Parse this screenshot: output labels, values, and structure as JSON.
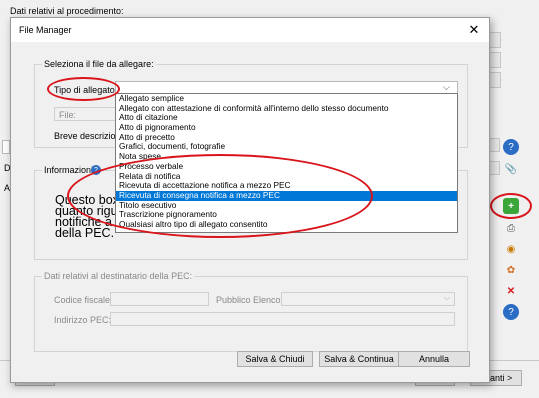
{
  "background": {
    "section_title": "Dati relativi al procedimento:",
    "label_D": "D",
    "label_Al": "Al",
    "next_button": "Avanti >"
  },
  "dialog": {
    "title": "File Manager",
    "close_glyph": "✕",
    "select_group": {
      "legend": "Seleziona il file da allegare:",
      "type_label": "Tipo di allegato:",
      "file_placeholder": "File:",
      "description_label": "Breve descrizione"
    },
    "info_group": {
      "legend": "Informazioni:",
      "help_glyph": "?",
      "text_line1": "Questo box c",
      "text_line2": "quanto riguar",
      "text_line3": "notifiche a me",
      "text_line4": "della PEC."
    },
    "type_options": [
      "Allegato semplice",
      "Allegato con attestazione di conformità all'interno dello stesso documento",
      "Atto di citazione",
      "Atto di pignoramento",
      "Atto di precetto",
      "Grafici, documenti, fotografie",
      "Nota spese",
      "Processo verbale",
      "Relata di notifica",
      "Ricevuta di accettazione notifica a mezzo PEC",
      "Ricevuta di consegna notifica a mezzo PEC",
      "Titolo esecutivo",
      "Trascrizione pignoramento",
      "Qualsiasi altro tipo di allegato consentito"
    ],
    "selected_option_index": 10,
    "recipient_group": {
      "legend": "Dati relativi al destinatario della PEC:",
      "tax_code_label": "Codice fiscale:",
      "public_register_label": "Pubblico Elenco:",
      "pec_address_label": "Indirizzo PEC:"
    },
    "buttons": {
      "save_close": "Salva & Chiudi",
      "save_continue": "Salva & Continua",
      "cancel": "Annulla"
    }
  },
  "colors": {
    "highlight": "#0078d7",
    "annotation": "#d9141b"
  }
}
